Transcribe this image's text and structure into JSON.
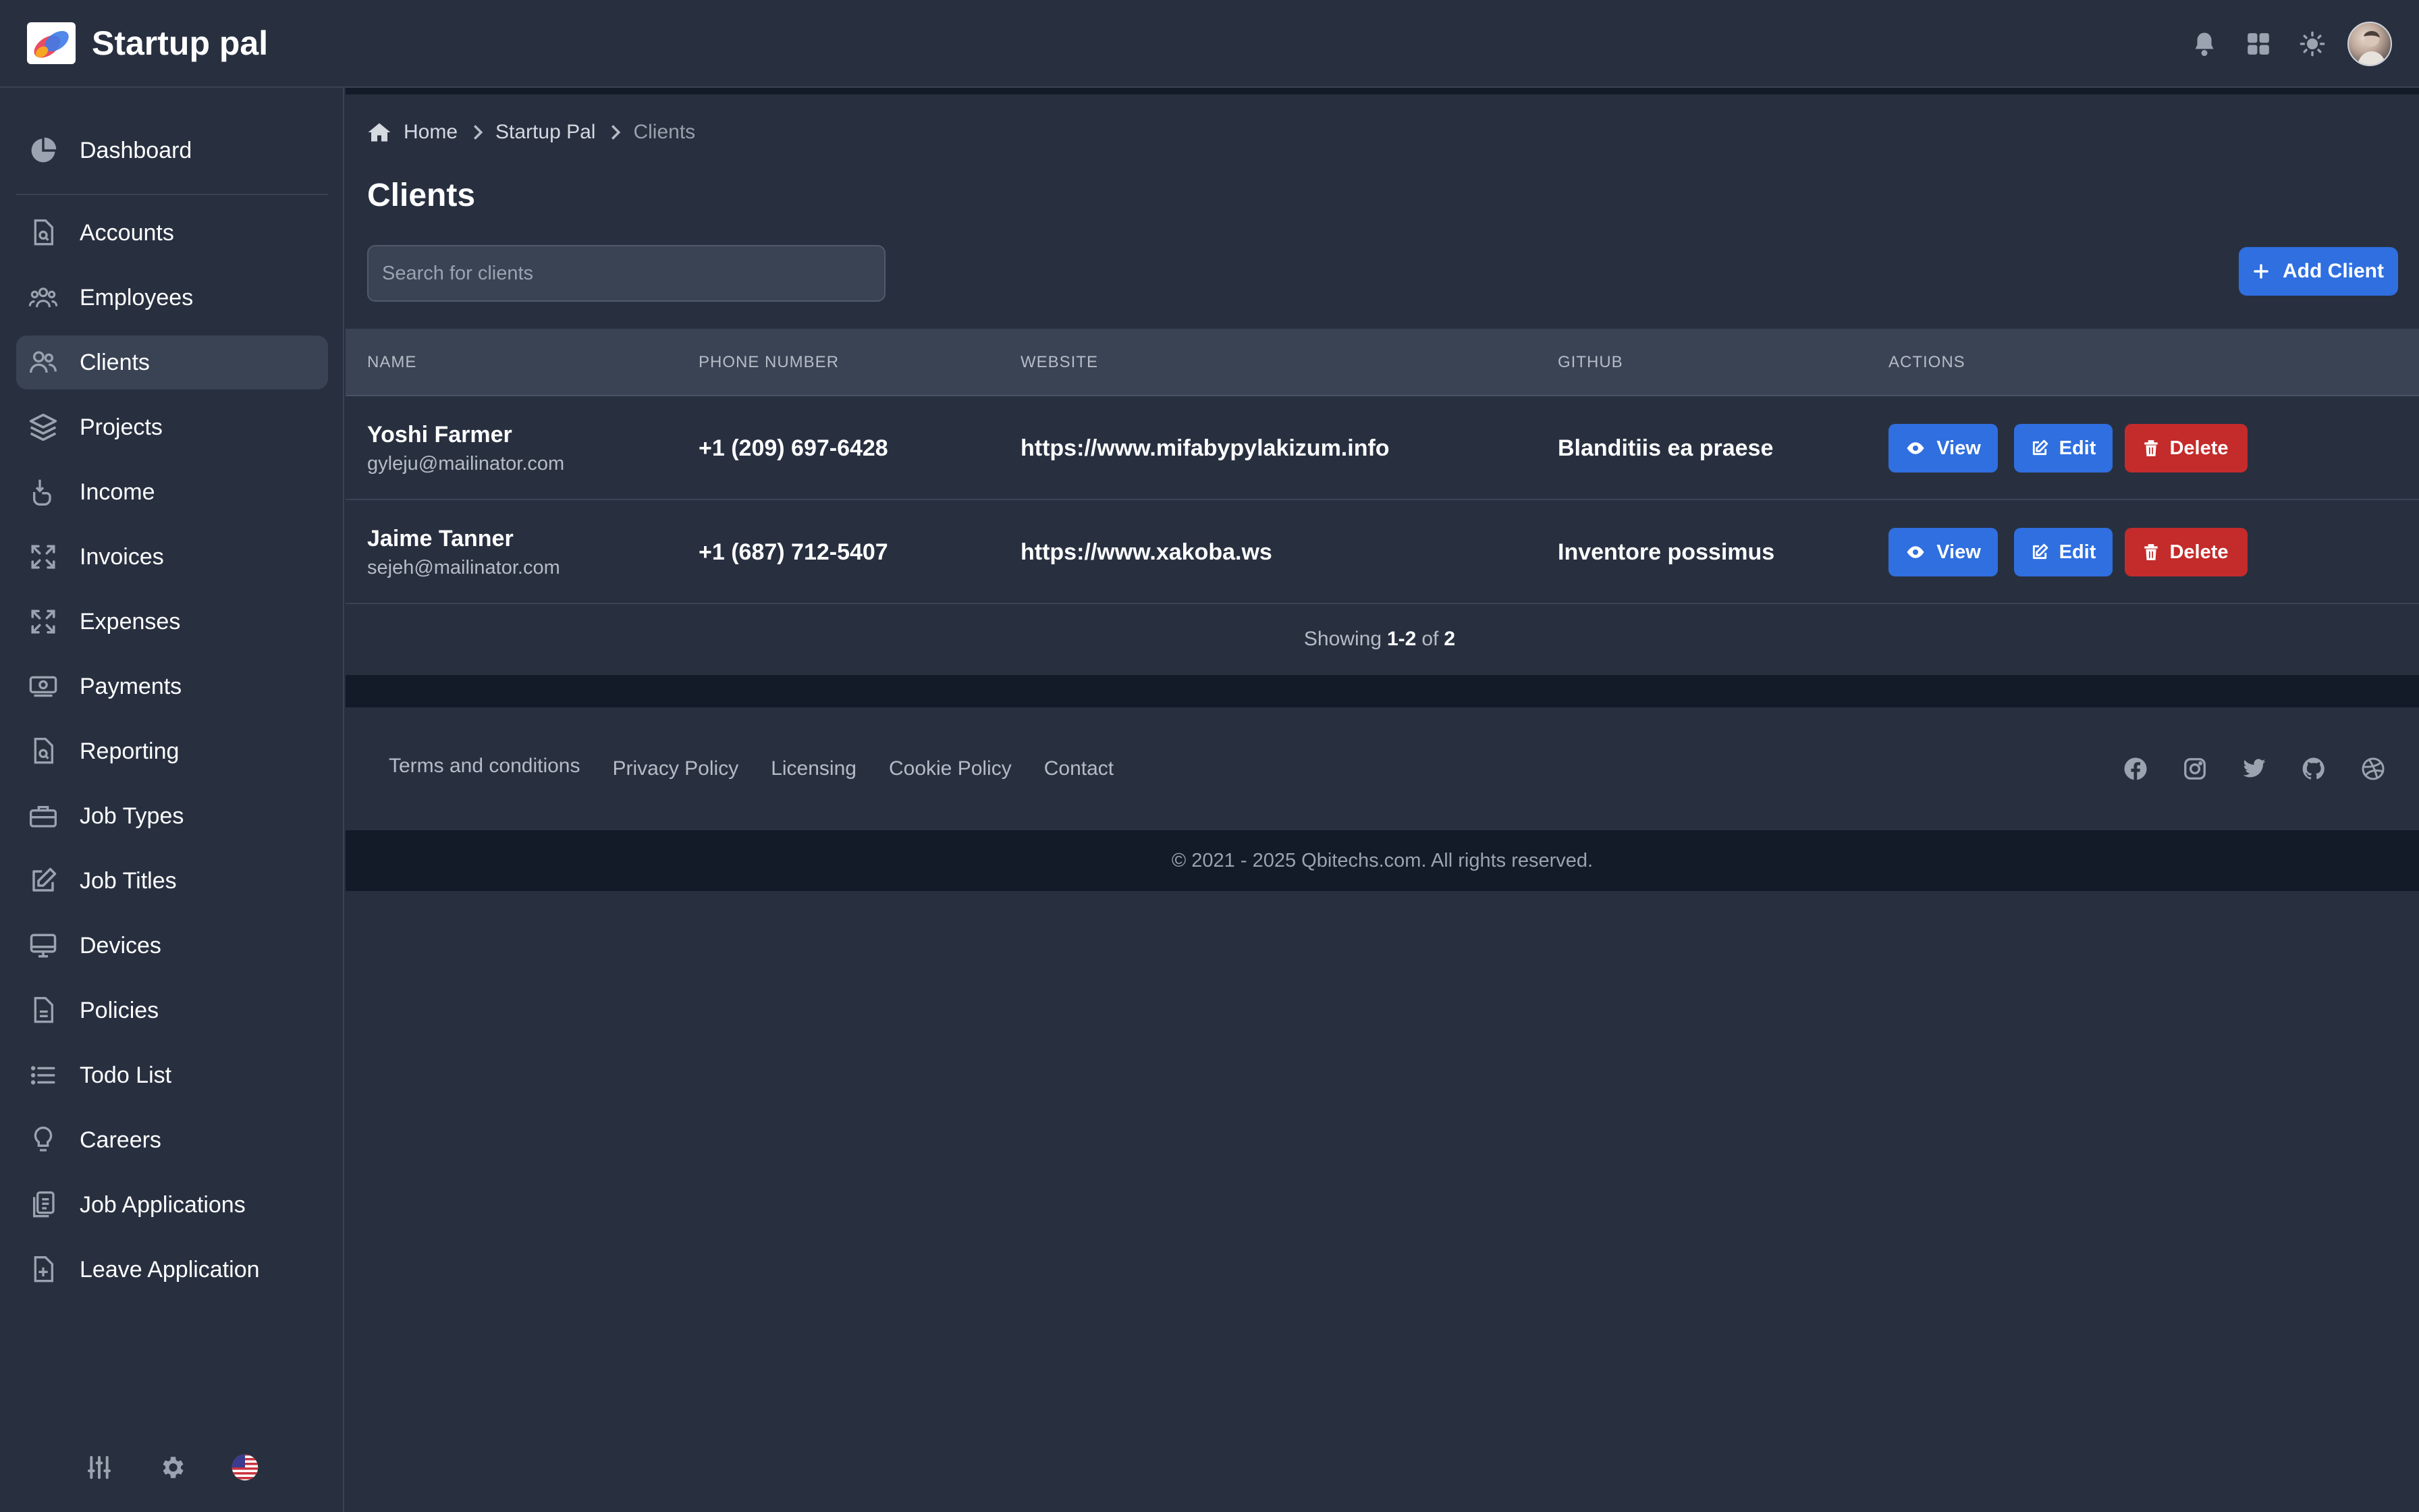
{
  "header": {
    "app_title": "Startup pal",
    "icons": [
      "bell-icon",
      "apps-grid-icon",
      "sun-icon",
      "user-avatar"
    ]
  },
  "sidebar": {
    "items": [
      {
        "label": "Dashboard",
        "icon": "pie-chart-icon"
      },
      {
        "label": "Accounts",
        "icon": "document-search-icon"
      },
      {
        "label": "Employees",
        "icon": "users-group-icon"
      },
      {
        "label": "Clients",
        "icon": "users-icon",
        "active": true
      },
      {
        "label": "Projects",
        "icon": "layers-icon"
      },
      {
        "label": "Income",
        "icon": "hand-coin-icon"
      },
      {
        "label": "Invoices",
        "icon": "expand-icon"
      },
      {
        "label": "Expenses",
        "icon": "expand-icon"
      },
      {
        "label": "Payments",
        "icon": "cash-icon"
      },
      {
        "label": "Reporting",
        "icon": "document-search-icon"
      },
      {
        "label": "Job Types",
        "icon": "briefcase-icon"
      },
      {
        "label": "Job Titles",
        "icon": "pencil-square-icon"
      },
      {
        "label": "Devices",
        "icon": "monitor-icon"
      },
      {
        "label": "Policies",
        "icon": "document-icon"
      },
      {
        "label": "Todo List",
        "icon": "list-icon"
      },
      {
        "label": "Careers",
        "icon": "lightbulb-icon"
      },
      {
        "label": "Job Applications",
        "icon": "clipboard-icon"
      },
      {
        "label": "Leave Application",
        "icon": "document-plus-icon"
      }
    ],
    "bottom_icons": [
      "sliders-icon",
      "gear-icon",
      "us-flag-icon"
    ]
  },
  "breadcrumb": {
    "items": [
      "Home",
      "Startup Pal",
      "Clients"
    ]
  },
  "page": {
    "title": "Clients",
    "search_placeholder": "Search for clients",
    "add_button": "Add Client"
  },
  "table": {
    "columns": [
      "NAME",
      "PHONE NUMBER",
      "WEBSITE",
      "GITHUB",
      "ACTIONS"
    ],
    "rows": [
      {
        "name": "Yoshi Farmer",
        "email": "gyleju@mailinator.com",
        "phone": "+1 (209) 697-6428",
        "website": "https://www.mifabypylakizum.info",
        "github": "Blanditiis ea praese"
      },
      {
        "name": "Jaime Tanner",
        "email": "sejeh@mailinator.com",
        "phone": "+1 (687) 712-5407",
        "website": "https://www.xakoba.ws",
        "github": "Inventore possimus"
      }
    ],
    "actions": {
      "view": "View",
      "edit": "Edit",
      "delete": "Delete"
    },
    "footer": {
      "prefix": "Showing",
      "range": "1-2",
      "of": "of",
      "total": "2"
    }
  },
  "footer": {
    "links": [
      "Terms and conditions",
      "Privacy Policy",
      "Licensing",
      "Cookie Policy",
      "Contact"
    ],
    "socials": [
      "facebook-icon",
      "instagram-icon",
      "twitter-icon",
      "github-icon",
      "dribbble-icon"
    ],
    "copyright": "© 2021 - 2025 Qbitechs.com. All rights reserved."
  },
  "colors": {
    "background": "#283040",
    "surface": "#3a4354",
    "dark_band": "#131a28",
    "primary": "#2f6fe0",
    "danger": "#c42b2b"
  }
}
